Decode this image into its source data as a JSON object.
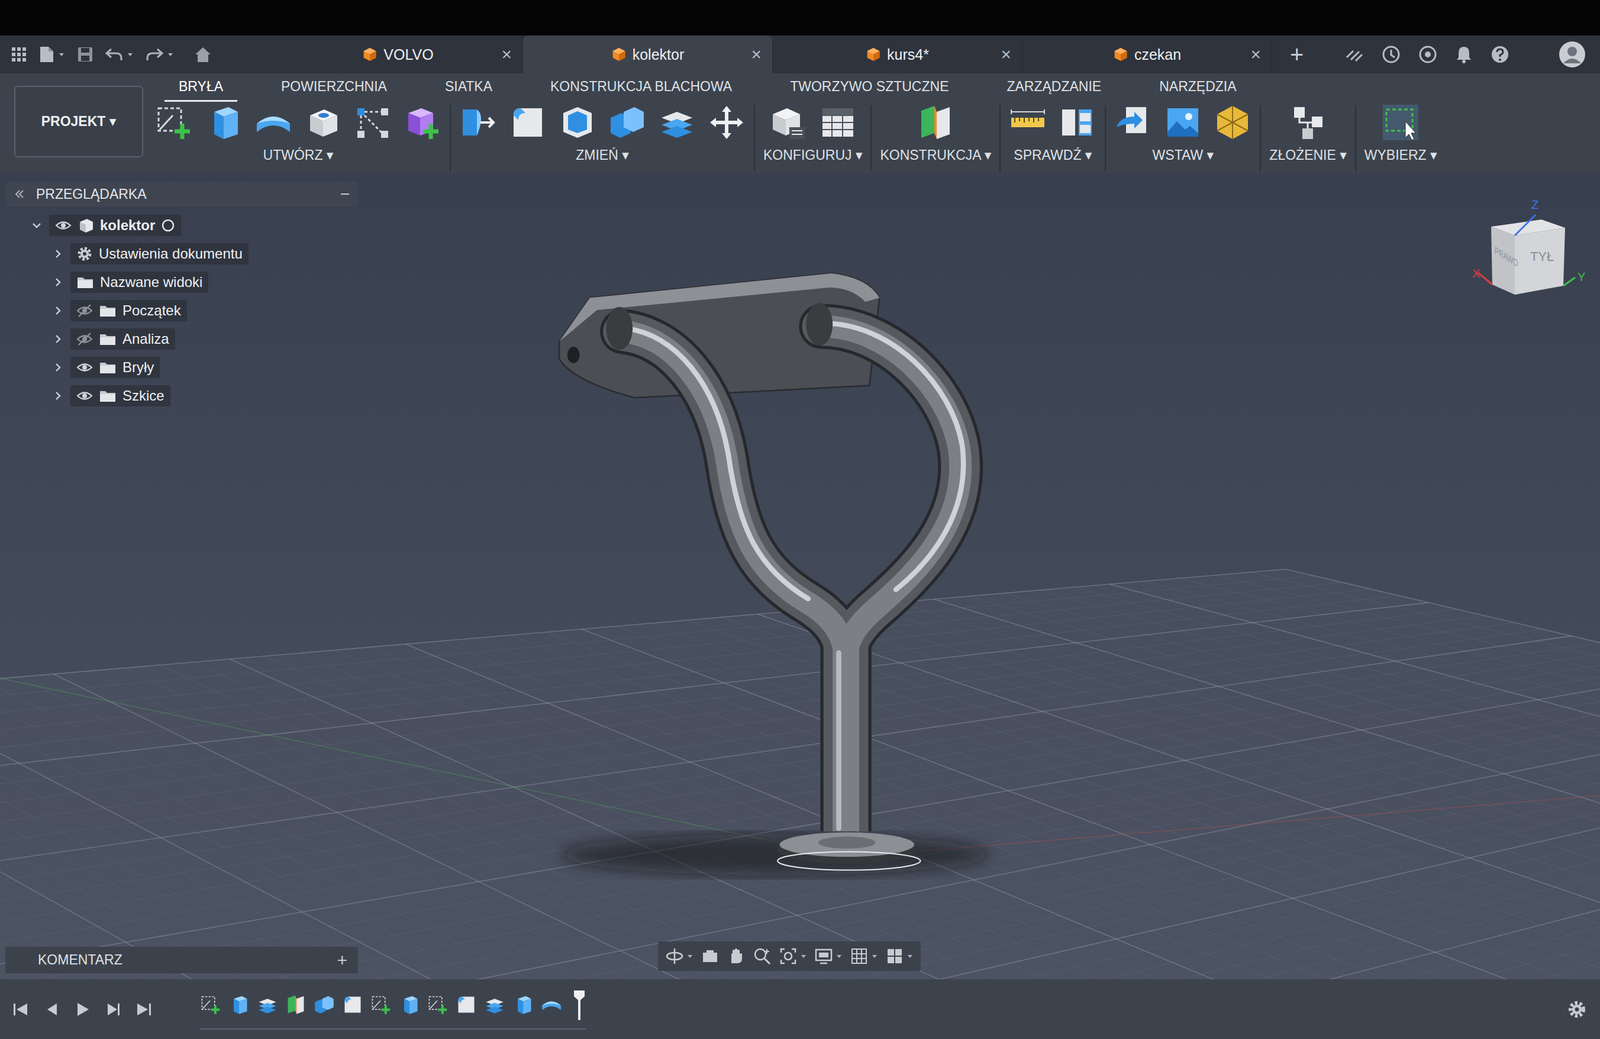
{
  "doc_tabs": [
    {
      "label": "VOLVO",
      "selected": false,
      "close": "×"
    },
    {
      "label": "kolektor",
      "selected": true,
      "close": "×"
    },
    {
      "label": "kurs4*",
      "selected": false,
      "close": "×"
    },
    {
      "label": "czekan",
      "selected": false,
      "close": "×"
    }
  ],
  "new_tab": "+",
  "ribbon": {
    "project_button": "PROJEKT ▾",
    "tabs": [
      {
        "label": "BRYŁA",
        "selected": true
      },
      {
        "label": "POWIERZCHNIA",
        "selected": false
      },
      {
        "label": "SIATKA",
        "selected": false
      },
      {
        "label": "KONSTRUKCJA BLACHOWA",
        "selected": false
      },
      {
        "label": "TWORZYWO SZTUCZNE",
        "selected": false
      },
      {
        "label": "ZARZĄDZANIE",
        "selected": false
      },
      {
        "label": "NARZĘDZIA",
        "selected": false
      }
    ],
    "groups": [
      {
        "label": "UTWÓRZ ▾"
      },
      {
        "label": "ZMIEŃ ▾"
      },
      {
        "label": "KONFIGURUJ ▾"
      },
      {
        "label": "KONSTRUKCJA ▾"
      },
      {
        "label": "SPRAWDŹ ▾"
      },
      {
        "label": "WSTAW ▾"
      },
      {
        "label": "ZŁOŻENIE ▾"
      },
      {
        "label": "WYBIERZ ▾"
      }
    ]
  },
  "browser": {
    "title": "PRZEGLĄDARKA",
    "collapse": "−",
    "root": {
      "label": "kolektor",
      "expanded": true,
      "visible": true
    },
    "items": [
      {
        "label": "Ustawienia dokumentu",
        "kind": "settings",
        "expanded": false
      },
      {
        "label": "Nazwane widoki",
        "kind": "folder",
        "expanded": false
      },
      {
        "label": "Początek",
        "kind": "layer",
        "expanded": false,
        "visible": false
      },
      {
        "label": "Analiza",
        "kind": "layer",
        "expanded": false,
        "visible": false
      },
      {
        "label": "Bryły",
        "kind": "layer",
        "expanded": false,
        "visible": true
      },
      {
        "label": "Szkice",
        "kind": "layer",
        "expanded": false,
        "visible": true
      }
    ]
  },
  "comments": {
    "title": "KOMENTARZ",
    "add": "+"
  },
  "viewcube": {
    "side": "PRAWO",
    "front": "TYŁ",
    "axes": [
      {
        "label": "Z",
        "color": "#3f74e6"
      },
      {
        "label": "X",
        "color": "#d64040"
      },
      {
        "label": "Y",
        "color": "#3fbf55"
      }
    ]
  }
}
